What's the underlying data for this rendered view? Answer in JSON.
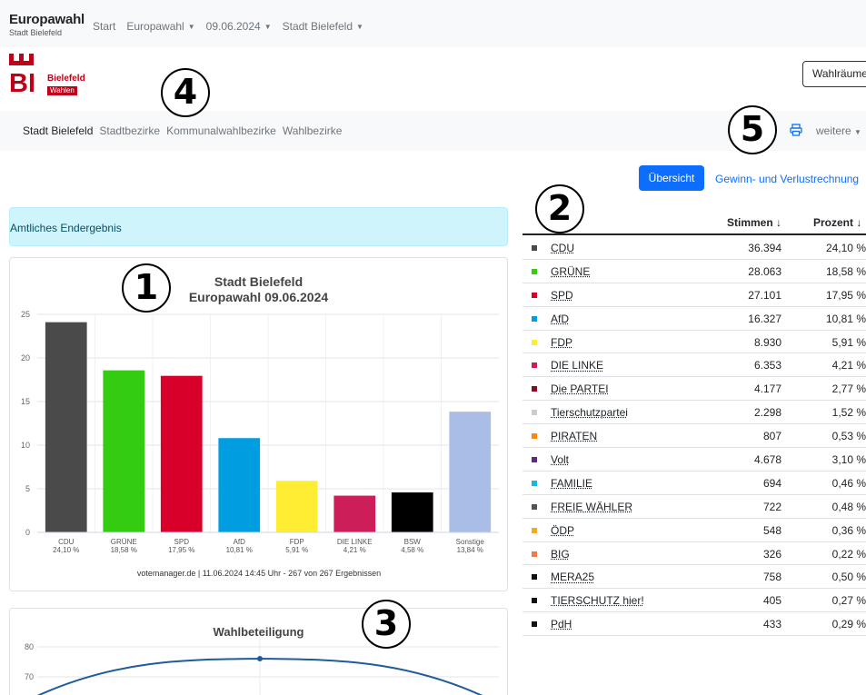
{
  "topbar": {
    "brand_title": "Europawahl",
    "brand_sub": "Stadt Bielefeld",
    "nav": [
      "Start",
      "Europawahl",
      "09.06.2024",
      "Stadt Bielefeld"
    ]
  },
  "logo": {
    "name": "Bielefeld",
    "tag": "Wahlen",
    "mark": "BI"
  },
  "rooms_button": "Wahlräume",
  "subnav": {
    "items": [
      "Stadt Bielefeld",
      "Stadtbezirke",
      "Kommunalwahlbezirke",
      "Wahlbezirke"
    ],
    "more": "weitere"
  },
  "buttons": {
    "overview": "Übersicht",
    "gain_loss": "Gewinn- und Verlustrechnung"
  },
  "alert": "Amtliches Endergebnis",
  "annotations": [
    "1",
    "2",
    "3",
    "4",
    "5"
  ],
  "chart_data": [
    {
      "type": "bar",
      "title": "Stadt Bielefeld",
      "subtitle": "Europawahl 09.06.2024",
      "categories": [
        "CDU",
        "GRÜNE",
        "SPD",
        "AfD",
        "FDP",
        "DIE LINKE",
        "BSW",
        "Sonstige"
      ],
      "category_sublabels": [
        "24,10 %",
        "18,58 %",
        "17,95 %",
        "10,81 %",
        "5,91 %",
        "4,21 %",
        "4,58 %",
        "13,84 %"
      ],
      "values": [
        24.1,
        18.58,
        17.95,
        10.81,
        5.91,
        4.21,
        4.58,
        13.84
      ],
      "colors": [
        "#4a4a4a",
        "#33cc11",
        "#d8002a",
        "#009ee0",
        "#ffed34",
        "#cc1f5a",
        "#000000",
        "#aabde6"
      ],
      "ylim": [
        0,
        25
      ],
      "yticks": [
        0,
        5,
        10,
        15,
        20,
        25
      ],
      "grid": true,
      "footer": "votemanager.de | 11.06.2024 14:45 Uhr - 267 von 267 Ergebnissen"
    },
    {
      "type": "line",
      "title": "Wahlbeteiligung",
      "yticks": [
        70,
        80
      ],
      "grid": true
    }
  ],
  "table": {
    "headers": {
      "votes": "Stimmen ↓",
      "percent": "Prozent ↓"
    },
    "rows": [
      {
        "party": "CDU",
        "votes": "36.394",
        "percent": "24,10 %",
        "color": "#4a4a4a"
      },
      {
        "party": "GRÜNE",
        "votes": "28.063",
        "percent": "18,58 %",
        "color": "#33cc11"
      },
      {
        "party": "SPD",
        "votes": "27.101",
        "percent": "17,95 %",
        "color": "#d8002a"
      },
      {
        "party": "AfD",
        "votes": "16.327",
        "percent": "10,81 %",
        "color": "#009ee0"
      },
      {
        "party": "FDP",
        "votes": "8.930",
        "percent": "5,91 %",
        "color": "#ffed34"
      },
      {
        "party": "DIE LINKE",
        "votes": "6.353",
        "percent": "4,21 %",
        "color": "#cc1f5a"
      },
      {
        "party": "Die PARTEI",
        "votes": "4.177",
        "percent": "2,77 %",
        "color": "#8b0a24"
      },
      {
        "party": "Tierschutzpartei",
        "votes": "2.298",
        "percent": "1,52 %",
        "color": "#cccccc"
      },
      {
        "party": "PIRATEN",
        "votes": "807",
        "percent": "0,53 %",
        "color": "#ff8800"
      },
      {
        "party": "Volt",
        "votes": "4.678",
        "percent": "3,10 %",
        "color": "#582c83"
      },
      {
        "party": "FAMILIE",
        "votes": "694",
        "percent": "0,46 %",
        "color": "#1ab3e6"
      },
      {
        "party": "FREIE WÄHLER",
        "votes": "722",
        "percent": "0,48 %",
        "color": "#555555"
      },
      {
        "party": "ÖDP",
        "votes": "548",
        "percent": "0,36 %",
        "color": "#f5a623"
      },
      {
        "party": "BIG",
        "votes": "326",
        "percent": "0,22 %",
        "color": "#f07a4a"
      },
      {
        "party": "MERA25",
        "votes": "758",
        "percent": "0,50 %",
        "color": "#111111"
      },
      {
        "party": "TIERSCHUTZ hier!",
        "votes": "405",
        "percent": "0,27 %",
        "color": "#111111"
      },
      {
        "party": "PdH",
        "votes": "433",
        "percent": "0,29 %",
        "color": "#111111"
      }
    ]
  }
}
